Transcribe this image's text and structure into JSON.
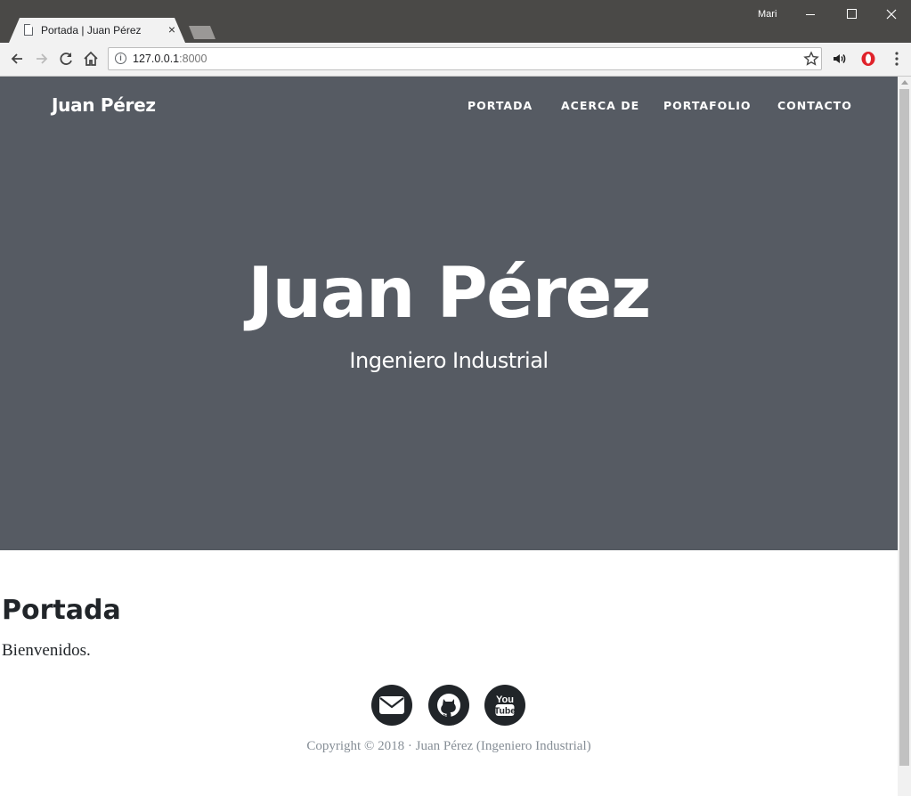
{
  "browser": {
    "tab_title": "Portada | Juan Pérez",
    "tab_close": "×",
    "user": "Mari",
    "url_host": "127.0.0.1",
    "url_port": ":8000"
  },
  "site": {
    "brand": "Juan Pérez",
    "nav": [
      {
        "label": "PORTADA"
      },
      {
        "label": "ACERCA DE"
      },
      {
        "label": "PORTAFOLIO"
      },
      {
        "label": "CONTACTO"
      }
    ],
    "hero_title": "Juan Pérez",
    "hero_subtitle": "Ingeniero Industrial",
    "hero_bg": "#565b63"
  },
  "content": {
    "heading": "Portada",
    "text": "Bienvenidos."
  },
  "footer": {
    "social": [
      {
        "icon": "envelope-icon"
      },
      {
        "icon": "github-icon"
      },
      {
        "icon": "youtube-icon",
        "text_top": "You",
        "text_bottom": "Tube"
      }
    ],
    "copyright": "Copyright © 2018 · Juan Pérez (Ingeniero Industrial)"
  }
}
